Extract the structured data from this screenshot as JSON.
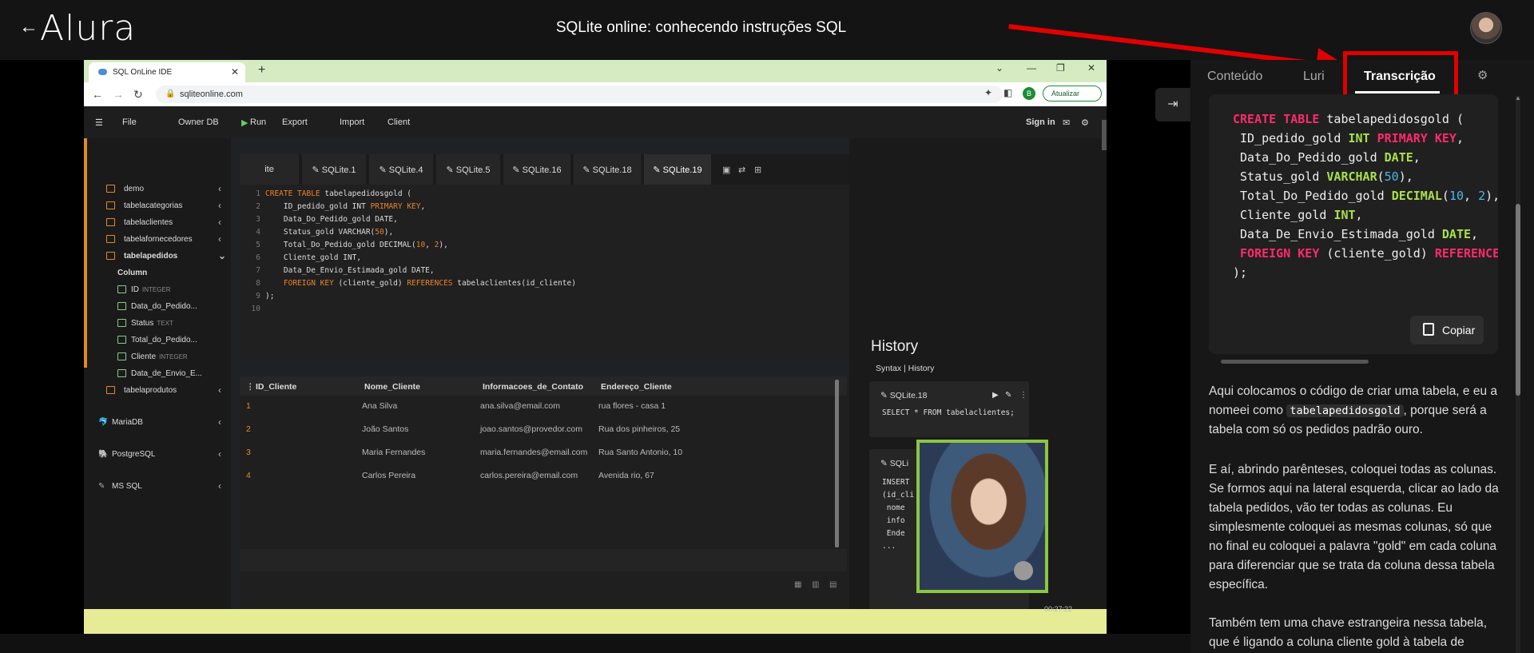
{
  "header": {
    "back_icon": "←",
    "logo": "Alura",
    "title": "SQLite online: conhecendo instruções SQL"
  },
  "browser": {
    "tab_title": "SQL OnLine IDE",
    "tab_close": "✕",
    "new_tab": "+",
    "url": "sqliteonline.com",
    "update_button": "Atualizar",
    "profile_letter": "B",
    "window_controls": [
      "⌄",
      "—",
      "❐",
      "✕"
    ]
  },
  "app_toolbar": {
    "menu_icon": "☰",
    "file": "File",
    "owner_db": "Owner DB",
    "run": "Run",
    "export": "Export",
    "import": "Import",
    "client": "Client",
    "sign_in": "Sign in"
  },
  "sidebar": {
    "tables": [
      {
        "label": "demo"
      },
      {
        "label": "tabelacategorias"
      },
      {
        "label": "tabelaclientes"
      },
      {
        "label": "tabelafornecedores"
      },
      {
        "label": "tabelapedidos"
      }
    ],
    "column_header": "Column",
    "columns": [
      {
        "label": "ID",
        "type": "INTEGER"
      },
      {
        "label": "Data_do_Pedido...",
        "type": ""
      },
      {
        "label": "Status",
        "type": "TEXT"
      },
      {
        "label": "Total_do_Pedido...",
        "type": ""
      },
      {
        "label": "Cliente",
        "type": "INTEGER"
      },
      {
        "label": "Data_de_Envio_E...",
        "type": ""
      }
    ],
    "last_table": "tabelaprodutos",
    "databases": [
      "MariaDB",
      "PostgreSQL",
      "MS SQL"
    ]
  },
  "editor_tabs": [
    "ite",
    "SQLite.1",
    "SQLite.4",
    "SQLite.5",
    "SQLite.16",
    "SQLite.18",
    "SQLite.19"
  ],
  "editor": {
    "lines": [
      "1",
      "2",
      "3",
      "4",
      "5",
      "6",
      "7",
      "8",
      "9",
      "10"
    ]
  },
  "results": {
    "headers": [
      "ID_Cliente",
      "Nome_Cliente",
      "Informacoes_de_Contato",
      "Endereço_Cliente"
    ],
    "rows": [
      [
        "1",
        "Ana Silva",
        "ana.silva@email.com",
        "rua flores - casa 1"
      ],
      [
        "2",
        "João Santos",
        "joao.santos@provedor.com",
        "Rua dos pinheiros, 25"
      ],
      [
        "3",
        "Maria Fernandes",
        "maria.fernandes@email.com",
        "Rua Santo Antonio, 10"
      ],
      [
        "4",
        "Carlos Pereira",
        "carlos.pereira@email.com",
        "Avenida rio, 67"
      ]
    ]
  },
  "history": {
    "title": "History",
    "subtitle": "Syntax  |  History",
    "cards": [
      {
        "name": "SQLite.18",
        "code": "SELECT * FROM tabelaclientes;"
      },
      {
        "name": "SQLi",
        "code": "INSERT\n(id_cli\n nome\n info\n Ende\n..."
      }
    ],
    "timestamp": "00:27:22"
  },
  "side_panel": {
    "tabs": [
      "Conteúdo",
      "Luri",
      "Transcrição"
    ],
    "copy_button": "Copiar",
    "code_lines": [
      "CREATE TABLE tabelapedidosgold (",
      " ID_pedido_gold INT PRIMARY KEY,",
      " Data_Do_Pedido_gold DATE,",
      " Status_gold VARCHAR(50),",
      " Total_Do_Pedido_gold DECIMAL(10, 2),",
      " Cliente_gold INT,",
      " Data_De_Envio_Estimada_gold DATE,",
      " FOREIGN KEY (cliente_gold) REFERENCE",
      ");"
    ],
    "para1_a": "Aqui colocamos o código de criar uma tabela, e eu a nomeei como ",
    "para1_code": "tabelapedidosgold",
    "para1_b": ", porque será a tabela com só os pedidos padrão ouro.",
    "para2": "E aí, abrindo parênteses, coloquei todas as colunas. Se formos aqui na lateral esquerda, clicar ao lado da tabela pedidos, vão ter todas as colunas. Eu simplesmente coloquei as mesmas colunas, só que no final eu coloquei a palavra \"gold\" em cada coluna para diferenciar que se trata da coluna dessa tabela específica.",
    "para3": "Também tem uma chave estrangeira nessa tabela, que é ligando a coluna cliente gold à tabela de"
  },
  "colors": {
    "annotation": "#e00000",
    "accent_orange": "#e08a2a",
    "webcam_border": "#8cc63f"
  }
}
